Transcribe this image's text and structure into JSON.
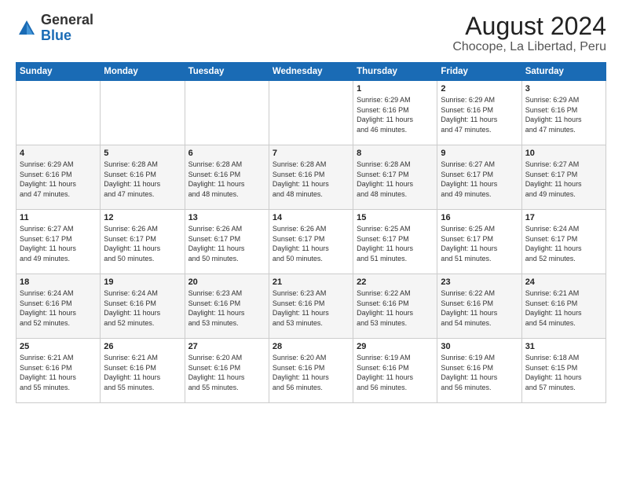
{
  "header": {
    "logo_general": "General",
    "logo_blue": "Blue",
    "title": "August 2024",
    "subtitle": "Chocope, La Libertad, Peru"
  },
  "days_of_week": [
    "Sunday",
    "Monday",
    "Tuesday",
    "Wednesday",
    "Thursday",
    "Friday",
    "Saturday"
  ],
  "weeks": [
    [
      {
        "day": "",
        "info": ""
      },
      {
        "day": "",
        "info": ""
      },
      {
        "day": "",
        "info": ""
      },
      {
        "day": "",
        "info": ""
      },
      {
        "day": "1",
        "info": "Sunrise: 6:29 AM\nSunset: 6:16 PM\nDaylight: 11 hours\nand 46 minutes."
      },
      {
        "day": "2",
        "info": "Sunrise: 6:29 AM\nSunset: 6:16 PM\nDaylight: 11 hours\nand 47 minutes."
      },
      {
        "day": "3",
        "info": "Sunrise: 6:29 AM\nSunset: 6:16 PM\nDaylight: 11 hours\nand 47 minutes."
      }
    ],
    [
      {
        "day": "4",
        "info": "Sunrise: 6:29 AM\nSunset: 6:16 PM\nDaylight: 11 hours\nand 47 minutes."
      },
      {
        "day": "5",
        "info": "Sunrise: 6:28 AM\nSunset: 6:16 PM\nDaylight: 11 hours\nand 47 minutes."
      },
      {
        "day": "6",
        "info": "Sunrise: 6:28 AM\nSunset: 6:16 PM\nDaylight: 11 hours\nand 48 minutes."
      },
      {
        "day": "7",
        "info": "Sunrise: 6:28 AM\nSunset: 6:16 PM\nDaylight: 11 hours\nand 48 minutes."
      },
      {
        "day": "8",
        "info": "Sunrise: 6:28 AM\nSunset: 6:17 PM\nDaylight: 11 hours\nand 48 minutes."
      },
      {
        "day": "9",
        "info": "Sunrise: 6:27 AM\nSunset: 6:17 PM\nDaylight: 11 hours\nand 49 minutes."
      },
      {
        "day": "10",
        "info": "Sunrise: 6:27 AM\nSunset: 6:17 PM\nDaylight: 11 hours\nand 49 minutes."
      }
    ],
    [
      {
        "day": "11",
        "info": "Sunrise: 6:27 AM\nSunset: 6:17 PM\nDaylight: 11 hours\nand 49 minutes."
      },
      {
        "day": "12",
        "info": "Sunrise: 6:26 AM\nSunset: 6:17 PM\nDaylight: 11 hours\nand 50 minutes."
      },
      {
        "day": "13",
        "info": "Sunrise: 6:26 AM\nSunset: 6:17 PM\nDaylight: 11 hours\nand 50 minutes."
      },
      {
        "day": "14",
        "info": "Sunrise: 6:26 AM\nSunset: 6:17 PM\nDaylight: 11 hours\nand 50 minutes."
      },
      {
        "day": "15",
        "info": "Sunrise: 6:25 AM\nSunset: 6:17 PM\nDaylight: 11 hours\nand 51 minutes."
      },
      {
        "day": "16",
        "info": "Sunrise: 6:25 AM\nSunset: 6:17 PM\nDaylight: 11 hours\nand 51 minutes."
      },
      {
        "day": "17",
        "info": "Sunrise: 6:24 AM\nSunset: 6:17 PM\nDaylight: 11 hours\nand 52 minutes."
      }
    ],
    [
      {
        "day": "18",
        "info": "Sunrise: 6:24 AM\nSunset: 6:16 PM\nDaylight: 11 hours\nand 52 minutes."
      },
      {
        "day": "19",
        "info": "Sunrise: 6:24 AM\nSunset: 6:16 PM\nDaylight: 11 hours\nand 52 minutes."
      },
      {
        "day": "20",
        "info": "Sunrise: 6:23 AM\nSunset: 6:16 PM\nDaylight: 11 hours\nand 53 minutes."
      },
      {
        "day": "21",
        "info": "Sunrise: 6:23 AM\nSunset: 6:16 PM\nDaylight: 11 hours\nand 53 minutes."
      },
      {
        "day": "22",
        "info": "Sunrise: 6:22 AM\nSunset: 6:16 PM\nDaylight: 11 hours\nand 53 minutes."
      },
      {
        "day": "23",
        "info": "Sunrise: 6:22 AM\nSunset: 6:16 PM\nDaylight: 11 hours\nand 54 minutes."
      },
      {
        "day": "24",
        "info": "Sunrise: 6:21 AM\nSunset: 6:16 PM\nDaylight: 11 hours\nand 54 minutes."
      }
    ],
    [
      {
        "day": "25",
        "info": "Sunrise: 6:21 AM\nSunset: 6:16 PM\nDaylight: 11 hours\nand 55 minutes."
      },
      {
        "day": "26",
        "info": "Sunrise: 6:21 AM\nSunset: 6:16 PM\nDaylight: 11 hours\nand 55 minutes."
      },
      {
        "day": "27",
        "info": "Sunrise: 6:20 AM\nSunset: 6:16 PM\nDaylight: 11 hours\nand 55 minutes."
      },
      {
        "day": "28",
        "info": "Sunrise: 6:20 AM\nSunset: 6:16 PM\nDaylight: 11 hours\nand 56 minutes."
      },
      {
        "day": "29",
        "info": "Sunrise: 6:19 AM\nSunset: 6:16 PM\nDaylight: 11 hours\nand 56 minutes."
      },
      {
        "day": "30",
        "info": "Sunrise: 6:19 AM\nSunset: 6:16 PM\nDaylight: 11 hours\nand 56 minutes."
      },
      {
        "day": "31",
        "info": "Sunrise: 6:18 AM\nSunset: 6:15 PM\nDaylight: 11 hours\nand 57 minutes."
      }
    ]
  ]
}
